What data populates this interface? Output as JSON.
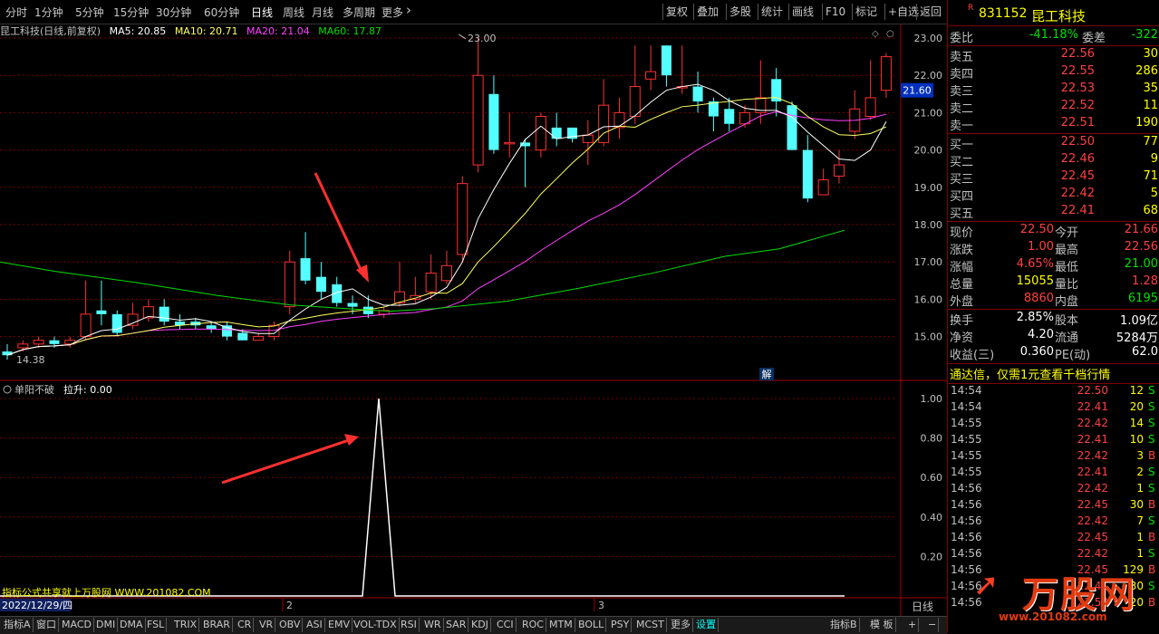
{
  "toolbar": {
    "periods": [
      "分时",
      "1分钟",
      "5分钟",
      "15分钟",
      "30分钟",
      "60分钟",
      "日线",
      "周线",
      "月线",
      "多周期",
      "更多"
    ],
    "active_period": "日线",
    "buttons": [
      "复权",
      "叠加",
      "多股",
      "统计",
      "画线",
      "F10",
      "标记",
      "+自选",
      "返回"
    ]
  },
  "chart_info": {
    "stock": "昆工科技(日线,前复权)",
    "ma5": "MA5: 20.85",
    "ma10": "MA10: 20.71",
    "ma20": "MA20: 21.04",
    "ma60": "MA60: 17.87",
    "high_mark": "23.00",
    "low_mark": "14.38",
    "current_price_tag": "21.60",
    "jie_badge": "解"
  },
  "price_axis": [
    "23.00",
    "22.00",
    "21.00",
    "20.00",
    "19.00",
    "18.00",
    "17.00",
    "16.00",
    "15.00"
  ],
  "indicator": {
    "name": "单阳不破",
    "value_label": "拉升: 0.00",
    "axis": [
      "1.00",
      "0.80",
      "0.60",
      "0.40",
      "0.20"
    ],
    "watermark": "指标公式共享就上万股网 WWW.201082.COM",
    "date_label": "2022/12/29/四",
    "month_marks": [
      "2",
      "3"
    ],
    "period_label": "日线"
  },
  "bottom_tabs": [
    "指标A",
    "窗口",
    "MACD",
    "DMI",
    "DMA",
    "FSL",
    "TRIX",
    "BRAR",
    "CR",
    "VR",
    "OBV",
    "ASI",
    "EMV",
    "VOL-TDX",
    "RSI",
    "WR",
    "SAR",
    "KDJ",
    "CCI",
    "ROC",
    "MTM",
    "BOLL",
    "PSY",
    "MCST",
    "更多",
    "设置"
  ],
  "bottom_right": [
    "指标B",
    "模 板",
    "+",
    "−"
  ],
  "quote": {
    "code": "831152",
    "name": "昆工科技",
    "badge": "R",
    "weibi_label": "委比",
    "weibi": "-41.18%",
    "weicha_label": "委差",
    "weicha": "-322",
    "asks": [
      {
        "label": "卖五",
        "price": "22.56",
        "vol": "30"
      },
      {
        "label": "卖四",
        "price": "22.55",
        "vol": "286"
      },
      {
        "label": "卖三",
        "price": "22.53",
        "vol": "35"
      },
      {
        "label": "卖二",
        "price": "22.52",
        "vol": "11"
      },
      {
        "label": "卖一",
        "price": "22.51",
        "vol": "190"
      }
    ],
    "bids": [
      {
        "label": "买一",
        "price": "22.50",
        "vol": "77"
      },
      {
        "label": "买二",
        "price": "22.46",
        "vol": "9"
      },
      {
        "label": "买三",
        "price": "22.45",
        "vol": "71"
      },
      {
        "label": "买四",
        "price": "22.42",
        "vol": "5"
      },
      {
        "label": "买五",
        "price": "22.41",
        "vol": "68"
      }
    ],
    "stats": [
      {
        "l1": "现价",
        "v1": "22.50",
        "c1": "red",
        "l2": "今开",
        "v2": "21.66",
        "c2": "red"
      },
      {
        "l1": "涨跌",
        "v1": "1.00",
        "c1": "red",
        "l2": "最高",
        "v2": "22.56",
        "c2": "red"
      },
      {
        "l1": "涨幅",
        "v1": "4.65%",
        "c1": "red",
        "l2": "最低",
        "v2": "21.00",
        "c2": "green"
      },
      {
        "l1": "总量",
        "v1": "15055",
        "c1": "yellow",
        "l2": "量比",
        "v2": "1.28",
        "c2": "red"
      },
      {
        "l1": "外盘",
        "v1": "8860",
        "c1": "red",
        "l2": "内盘",
        "v2": "6195",
        "c2": "green"
      }
    ],
    "finance": [
      {
        "l1": "换手",
        "v1": "2.85%",
        "l2": "股本",
        "v2": "1.09亿"
      },
      {
        "l1": "净资",
        "v1": "4.20",
        "l2": "流通",
        "v2": "5284万"
      },
      {
        "l1": "收益(三)",
        "v1": "0.360",
        "l2": "PE(动)",
        "v2": "62.0"
      }
    ],
    "promo": "通达信，仅需1元查看千档行情"
  },
  "ticks": [
    {
      "t": "14:54",
      "p": "22.50",
      "v": "12",
      "s": "S"
    },
    {
      "t": "14:54",
      "p": "22.41",
      "v": "20",
      "s": "S"
    },
    {
      "t": "14:55",
      "p": "22.42",
      "v": "14",
      "s": "S"
    },
    {
      "t": "14:55",
      "p": "22.41",
      "v": "10",
      "s": "S"
    },
    {
      "t": "14:55",
      "p": "22.42",
      "v": "3",
      "s": "B"
    },
    {
      "t": "14:55",
      "p": "22.41",
      "v": "2",
      "s": "S"
    },
    {
      "t": "14:56",
      "p": "22.42",
      "v": "1",
      "s": "S"
    },
    {
      "t": "14:56",
      "p": "22.45",
      "v": "30",
      "s": "B"
    },
    {
      "t": "14:56",
      "p": "22.42",
      "v": "7",
      "s": "S"
    },
    {
      "t": "14:56",
      "p": "22.45",
      "v": "1",
      "s": "B"
    },
    {
      "t": "14:56",
      "p": "22.42",
      "v": "1",
      "s": "S"
    },
    {
      "t": "14:56",
      "p": "22.45",
      "v": "129",
      "s": "B"
    },
    {
      "t": "14:56",
      "p": "22.41",
      "v": "30",
      "s": "S"
    },
    {
      "t": "14:56",
      "p": "22.50",
      "v": "20",
      "s": "B"
    }
  ],
  "logo": {
    "text": "万股网",
    "url": "www.201082.com"
  },
  "colors": {
    "up": "#ff3030",
    "down": "#54ffff",
    "ma5": "#ffffff",
    "ma10": "#ffff60",
    "ma20": "#ff40ff",
    "ma60": "#00dd00"
  }
}
